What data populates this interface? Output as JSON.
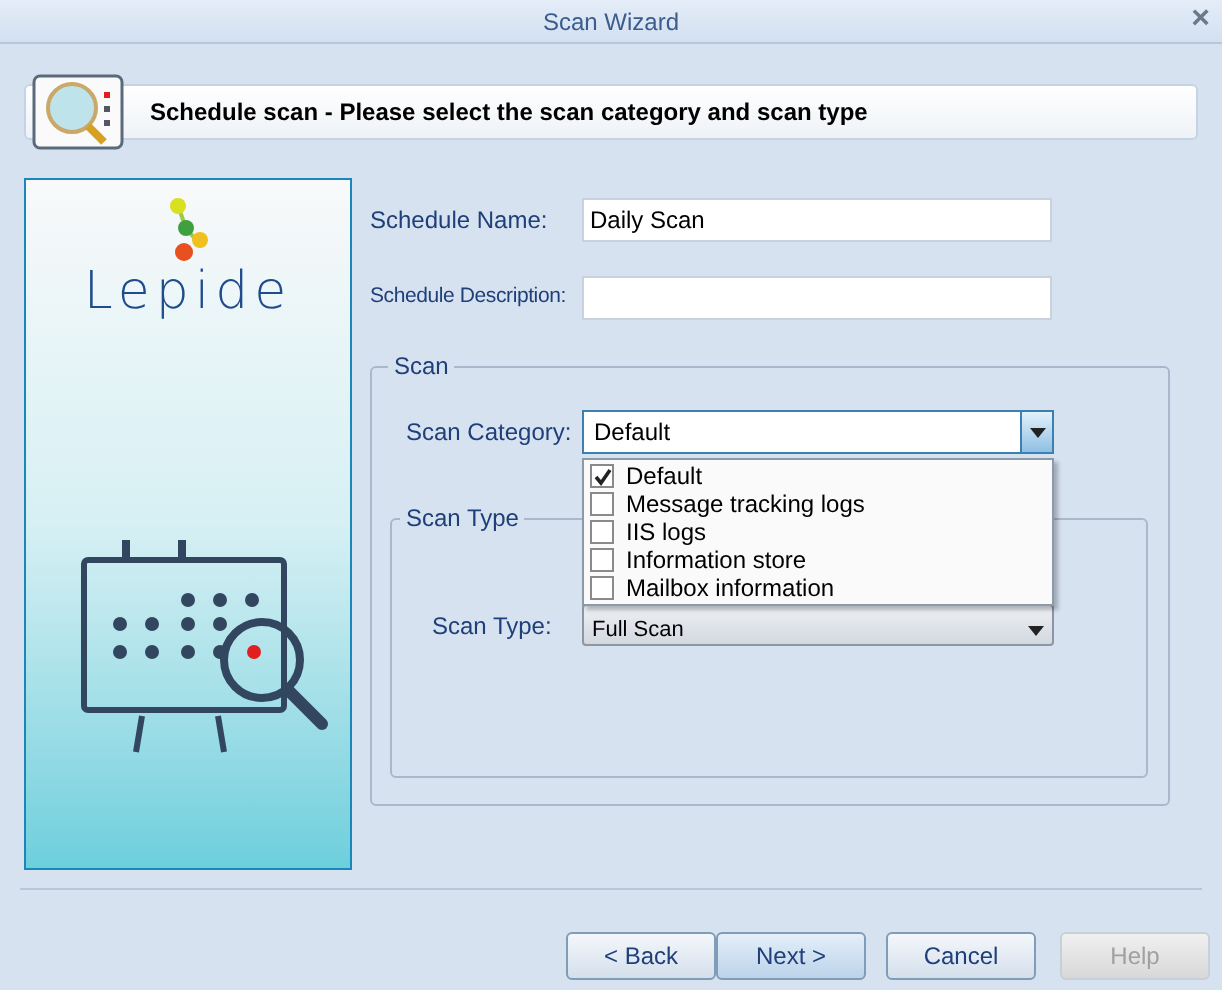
{
  "window": {
    "title": "Scan Wizard",
    "close": "×"
  },
  "header": {
    "title": "Schedule scan - Please select the scan category and scan type"
  },
  "sidebar": {
    "logo_text": "Lepide"
  },
  "form": {
    "schedule_name": {
      "label": "Schedule Name:",
      "value": "Daily Scan"
    },
    "schedule_description": {
      "label": "Schedule Description:"
    },
    "scan_group": {
      "legend": "Scan",
      "category_label": "Scan Category:",
      "category_value": "Default",
      "expanded": true,
      "options": [
        {
          "label": "Default",
          "checked": true
        },
        {
          "label": "Message tracking logs",
          "checked": false
        },
        {
          "label": "IIS logs",
          "checked": false
        },
        {
          "label": "Information store",
          "checked": false
        },
        {
          "label": "Mailbox information",
          "checked": false
        }
      ],
      "type_group": {
        "legend": "Scan Type",
        "type_label": "Scan Type:",
        "type_value": "Full Scan"
      }
    }
  },
  "buttons": [
    {
      "label": "< Back",
      "disabled": false,
      "selected": false
    },
    {
      "label": "Next >",
      "disabled": false,
      "selected": true
    },
    {
      "label": "Cancel",
      "disabled": false,
      "selected": false
    },
    {
      "label": "Help",
      "disabled": true
    }
  ]
}
